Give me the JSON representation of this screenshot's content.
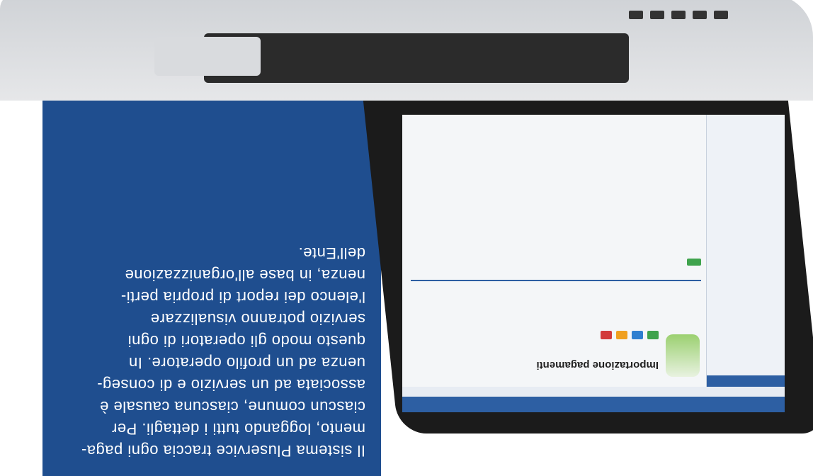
{
  "brochure": {
    "lines": [
      "Il sistema Pluservice traccia ogni paga-",
      "mento, loggando tutti i dettagli. Per",
      "ciascun comune, ciascuna causale è",
      "associata ad un servizio e di conseg-",
      "uenza ad un profilo operatore. In",
      "questo modo gli operatori di ogni",
      "servizio potranno visualizzare",
      "l'elenco dei report di propria perti-",
      "nenza, in base all'organizzazione",
      "dell'Ente."
    ]
  },
  "screen": {
    "page_title": "Importazione pagamenti",
    "colors": {
      "blue_panel": "#1f4e8f",
      "ui_blue": "#2d5fa3",
      "button_green": "#3fa34d",
      "button_blue": "#2f7fd0",
      "button_orange": "#f0a020",
      "button_red": "#d23a3a"
    },
    "icons": [
      "payments-logo-icon",
      "folder-icon",
      "laptop-ports"
    ]
  }
}
